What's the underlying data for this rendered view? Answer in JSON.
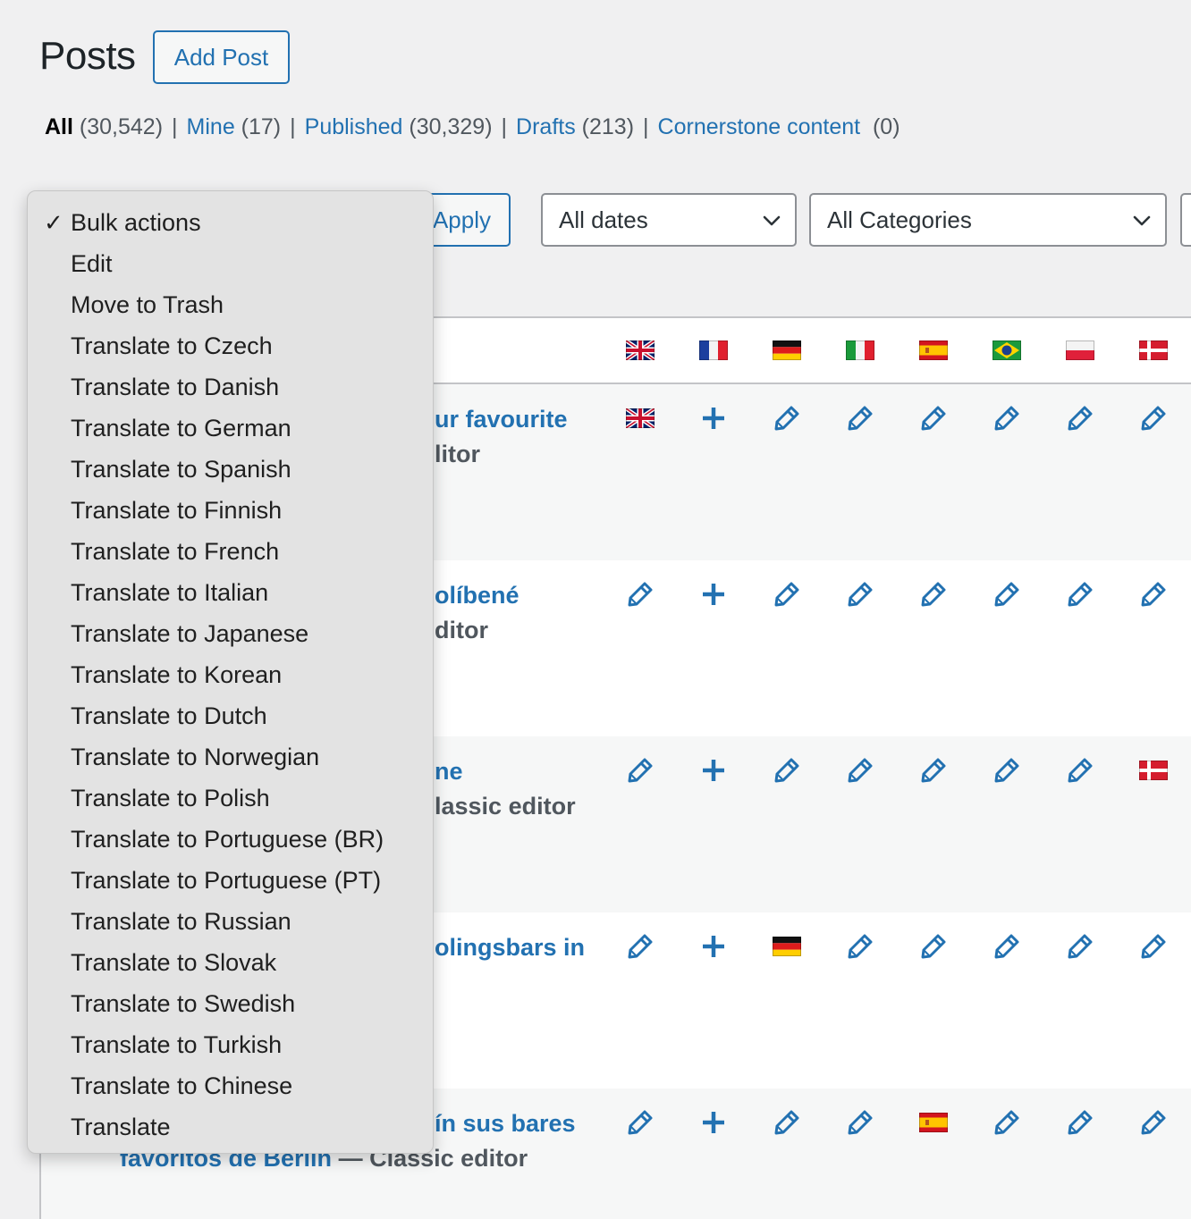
{
  "header": {
    "title": "Posts",
    "add_button": "Add Post"
  },
  "views": [
    {
      "label": "All",
      "count": "(30,542)"
    },
    {
      "label": "Mine",
      "count": "(17)"
    },
    {
      "label": "Published",
      "count": "(30,329)"
    },
    {
      "label": "Drafts",
      "count": "(213)"
    },
    {
      "label": "Cornerstone content",
      "count": "(0)"
    }
  ],
  "view_separator": "|",
  "filters": {
    "apply": "Apply",
    "dates": "All dates",
    "categories": "All Categories"
  },
  "bulk_actions": {
    "selected": "Bulk actions",
    "options": [
      "Bulk actions",
      "Edit",
      "Move to Trash",
      "Translate to Czech",
      "Translate to Danish",
      "Translate to German",
      "Translate to Spanish",
      "Translate to Finnish",
      "Translate to French",
      "Translate to Italian",
      "Translate to Japanese",
      "Translate to Korean",
      "Translate to Dutch",
      "Translate to Norwegian",
      "Translate to Polish",
      "Translate to Portuguese (BR)",
      "Translate to Portuguese (PT)",
      "Translate to Russian",
      "Translate to Slovak",
      "Translate to Swedish",
      "Translate to Turkish",
      "Translate to Chinese",
      "Translate"
    ]
  },
  "language_columns": [
    "uk-flag",
    "fr-flag",
    "de-flag",
    "it-flag",
    "es-flag",
    "br-flag",
    "pl-flag",
    "dk-flag"
  ],
  "rows": [
    {
      "title_line1": "ur favourite",
      "title_line2": "litor",
      "cells": [
        "flag:uk",
        "plus",
        "edit",
        "edit",
        "edit",
        "edit",
        "edit",
        "edit"
      ]
    },
    {
      "title_line1": "olíbené",
      "title_line2": "ditor",
      "cells": [
        "edit",
        "plus",
        "edit",
        "edit",
        "edit",
        "edit",
        "edit",
        "edit"
      ]
    },
    {
      "title_line1": "ne",
      "title_line2": "lassic editor",
      "cells": [
        "edit",
        "plus",
        "edit",
        "edit",
        "edit",
        "edit",
        "edit",
        "flag:dk"
      ]
    },
    {
      "title_line1": "olingsbars in",
      "title_line2": "",
      "cells": [
        "edit",
        "plus",
        "flag:de",
        "edit",
        "edit",
        "edit",
        "edit",
        "edit"
      ]
    },
    {
      "title_line1": "ín sus bares",
      "title_line2": "favoritos de Berlin",
      "title_state": " — Classic editor",
      "cells": [
        "edit",
        "plus",
        "edit",
        "edit",
        "flag:es",
        "edit",
        "edit",
        "edit"
      ]
    }
  ],
  "colors": {
    "link": "#2271b1",
    "icon": "#2271b1"
  }
}
